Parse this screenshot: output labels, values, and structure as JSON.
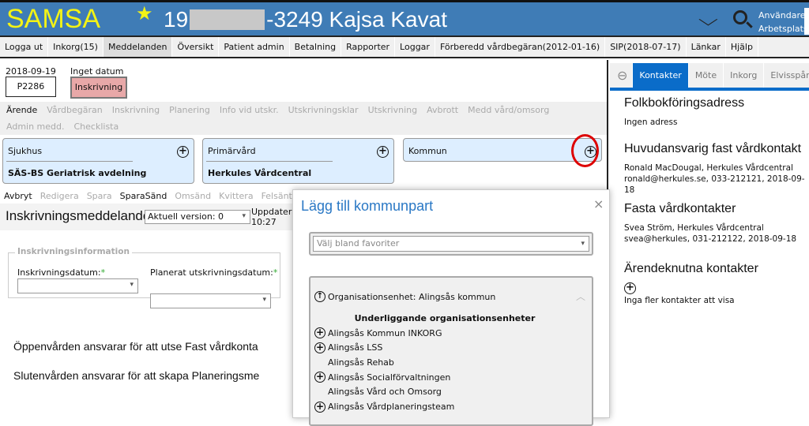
{
  "header": {
    "logo": "SAMSA",
    "patient_prefix": "19",
    "patient_suffix": "-3249 Kajsa Kavat",
    "user_label": "Användare:",
    "workplace_label": "Arbetsplats:"
  },
  "menu": [
    "Logga ut",
    "Inkorg(15)",
    "Meddelanden",
    "Översikt",
    "Patient admin",
    "Betalning",
    "Rapporter",
    "Loggar",
    "Förberedd vårdbegäran(2012-01-16)",
    "SIP(2018-07-17)",
    "Länkar",
    "Hjälp"
  ],
  "case": {
    "date": "2018-09-19",
    "id": "P2286",
    "status_date": "Inget datum",
    "status": "Inskrivning"
  },
  "case_tabs": [
    "Ärende",
    "Vårdbegäran",
    "Inskrivning",
    "Planering",
    "Info vid utskr.",
    "Utskrivningsklar",
    "Utskrivning",
    "Avbrott",
    "Medd vård/omsorg",
    "Admin medd.",
    "Checklista"
  ],
  "cards": [
    {
      "title": "Sjukhus",
      "value": "SÄS-BS Geriatrisk avdelning"
    },
    {
      "title": "Primärvård",
      "value": "Herkules Vårdcentral"
    },
    {
      "title": "Kommun",
      "value": ""
    }
  ],
  "toolbar": [
    "Avbryt",
    "Redigera",
    "Spara",
    "SparaSänd",
    "Omsänd",
    "Kvittera",
    "Felsänt"
  ],
  "form": {
    "title": "Inskrivningsmeddelande",
    "version": "Aktuell version: 0",
    "updated_label": "Uppdatera",
    "updated_time": "10:27",
    "legend": "Inskrivningsinformation",
    "field1": "Inskrivningsdatum:",
    "field2": "Planerat utskrivningsdatum:",
    "required": "*"
  },
  "body_text": [
    "Öppenvården ansvarar för att utse Fast vårdkonta",
    "Slutenvården ansvarar för att skapa Planeringsme"
  ],
  "dialog": {
    "title": "Lägg till kommunpart",
    "close": "×",
    "favorites_placeholder": "Välj bland favoriter",
    "parent": "Organisationsenhet: Alingsås kommun",
    "sub_heading": "Underliggande organisationsenheter",
    "units": [
      {
        "name": "Alingsås Kommun INKORG",
        "expandable": true
      },
      {
        "name": "Alingsås LSS",
        "expandable": true
      },
      {
        "name": "Alingsås Rehab",
        "expandable": false
      },
      {
        "name": "Alingsås Socialförvaltningen",
        "expandable": true
      },
      {
        "name": "Alingsås Vård och Omsorg",
        "expandable": false
      },
      {
        "name": "Alingsås Vårdplaneringsteam",
        "expandable": true
      }
    ]
  },
  "right": {
    "tabs": [
      "Kontakter",
      "Möte",
      "Inkorg",
      "Elvisspår"
    ],
    "sections": [
      {
        "heading": "Folkbokföringsadress",
        "lines": [
          "Ingen adress"
        ]
      },
      {
        "heading": "Huvudansvarig fast vårdkontakt",
        "lines": [
          "Ronald MacDougal, Herkules Vårdcentral",
          "ronald@herkules.se, 033-212121, 2018-09-18"
        ]
      },
      {
        "heading": "Fasta vårdkontakter",
        "lines": [
          "Svea Ström, Herkules Vårdcentral",
          "svea@herkules, 031-212122, 2018-09-18"
        ]
      },
      {
        "heading": "Ärendeknutna kontakter",
        "lines": [
          "Inga fler kontakter att visa"
        ]
      }
    ]
  },
  "colors": {
    "header": "#3f7cb6",
    "logo": "#f3f315",
    "accent": "#0a6cc9",
    "status": "#e8a8a8",
    "highlight": "#dd0000"
  }
}
